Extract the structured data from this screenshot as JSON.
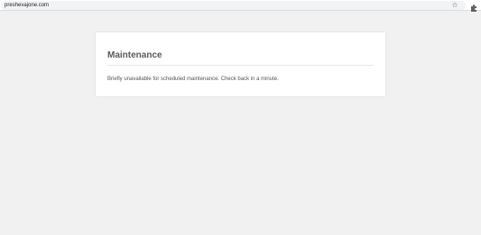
{
  "browser": {
    "url": "preshevajone.com",
    "bookmark_icon": "star-outline-icon",
    "extension_icon": "puzzle-piece-icon"
  },
  "card": {
    "title": "Maintenance",
    "message": "Briefly unavailable for scheduled maintenance. Check back in a minute."
  },
  "colors": {
    "page_background": "#f1f1f1",
    "card_background": "#ffffff",
    "title_text": "#595959",
    "body_text": "#555555"
  }
}
